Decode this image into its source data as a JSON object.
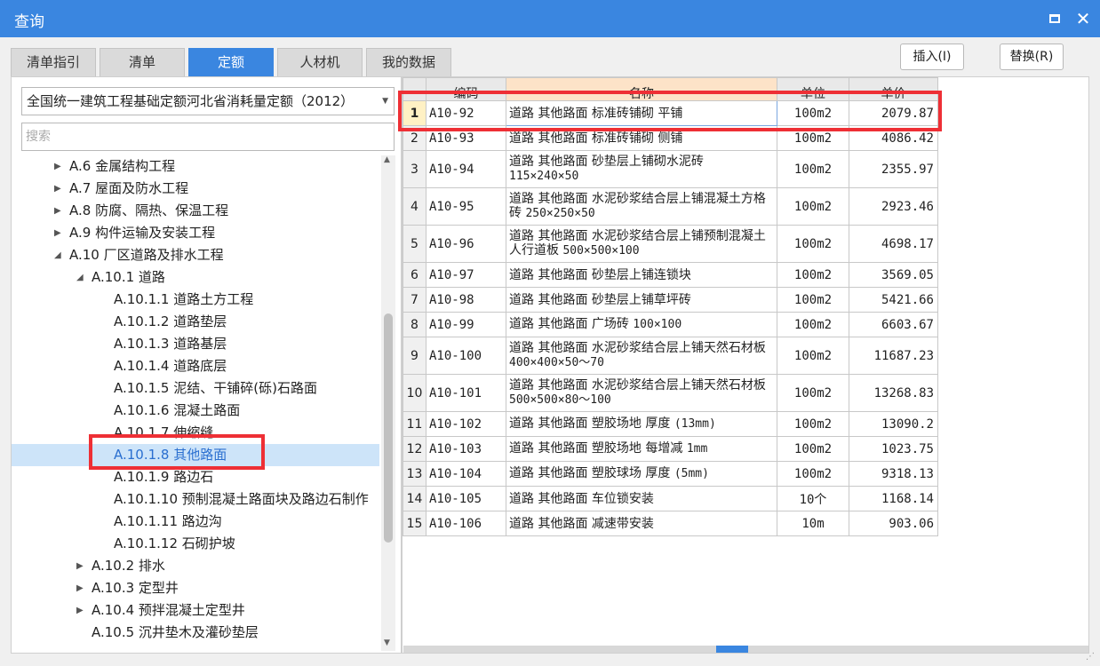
{
  "window": {
    "title": "查询"
  },
  "tabs": [
    {
      "label": "清单指引",
      "active": false
    },
    {
      "label": "清单",
      "active": false
    },
    {
      "label": "定额",
      "active": true
    },
    {
      "label": "人材机",
      "active": false
    },
    {
      "label": "我的数据",
      "active": false
    }
  ],
  "toolbar": {
    "insert_label": "插入(I)",
    "replace_label": "替换(R)"
  },
  "left": {
    "dropdown_value": "全国统一建筑工程基础定额河北省消耗量定额（2012）",
    "search_placeholder": "搜索",
    "tree": [
      {
        "label": "A.6 金属结构工程",
        "level": 0,
        "arrow": "collapsed"
      },
      {
        "label": "A.7 屋面及防水工程",
        "level": 0,
        "arrow": "collapsed"
      },
      {
        "label": "A.8 防腐、隔热、保温工程",
        "level": 0,
        "arrow": "collapsed"
      },
      {
        "label": "A.9 构件运输及安装工程",
        "level": 0,
        "arrow": "collapsed"
      },
      {
        "label": "A.10 厂区道路及排水工程",
        "level": 0,
        "arrow": "expanded"
      },
      {
        "label": "A.10.1 道路",
        "level": 1,
        "arrow": "expanded"
      },
      {
        "label": "A.10.1.1 道路土方工程",
        "level": 2,
        "arrow": "none"
      },
      {
        "label": "A.10.1.2 道路垫层",
        "level": 2,
        "arrow": "none"
      },
      {
        "label": "A.10.1.3 道路基层",
        "level": 2,
        "arrow": "none"
      },
      {
        "label": "A.10.1.4 道路底层",
        "level": 2,
        "arrow": "none"
      },
      {
        "label": "A.10.1.5 泥结、干铺碎(砾)石路面",
        "level": 2,
        "arrow": "none"
      },
      {
        "label": "A.10.1.6 混凝土路面",
        "level": 2,
        "arrow": "none"
      },
      {
        "label": "A.10.1.7 伸缩缝",
        "level": 2,
        "arrow": "none"
      },
      {
        "label": "A.10.1.8 其他路面",
        "level": 2,
        "arrow": "none",
        "selected": true
      },
      {
        "label": "A.10.1.9 路边石",
        "level": 2,
        "arrow": "none"
      },
      {
        "label": "A.10.1.10 预制混凝土路面块及路边石制作",
        "level": 2,
        "arrow": "none"
      },
      {
        "label": "A.10.1.11 路边沟",
        "level": 2,
        "arrow": "none"
      },
      {
        "label": "A.10.1.12 石砌护坡",
        "level": 2,
        "arrow": "none"
      },
      {
        "label": "A.10.2 排水",
        "level": 1,
        "arrow": "collapsed"
      },
      {
        "label": "A.10.3 定型井",
        "level": 1,
        "arrow": "collapsed"
      },
      {
        "label": "A.10.4 预拌混凝土定型井",
        "level": 1,
        "arrow": "collapsed"
      },
      {
        "label": "A.10.5 沉井垫木及灌砂垫层",
        "level": 1,
        "arrow": "none"
      }
    ]
  },
  "table": {
    "headers": {
      "code": "编码",
      "name": "名称",
      "unit": "单位",
      "price": "单价"
    },
    "rows": [
      {
        "idx": "1",
        "code": "A10-92",
        "name": "道路 其他路面 标准砖铺砌 平铺",
        "spec": "",
        "unit": "100m2",
        "price": "2079.87"
      },
      {
        "idx": "2",
        "code": "A10-93",
        "name": "道路 其他路面 标准砖铺砌 侧铺",
        "spec": "",
        "unit": "100m2",
        "price": "4086.42"
      },
      {
        "idx": "3",
        "code": "A10-94",
        "name": "道路 其他路面 砂垫层上铺砌水泥砖",
        "spec": "115×240×50",
        "unit": "100m2",
        "price": "2355.97"
      },
      {
        "idx": "4",
        "code": "A10-95",
        "name": "道路 其他路面 水泥砂浆结合层上铺混凝土方格砖",
        "spec": "250×250×50",
        "unit": "100m2",
        "price": "2923.46"
      },
      {
        "idx": "5",
        "code": "A10-96",
        "name": "道路 其他路面 水泥砂浆结合层上铺预制混凝土人行道板",
        "spec": "500×500×100",
        "unit": "100m2",
        "price": "4698.17"
      },
      {
        "idx": "6",
        "code": "A10-97",
        "name": "道路 其他路面 砂垫层上铺连锁块",
        "spec": "",
        "unit": "100m2",
        "price": "3569.05"
      },
      {
        "idx": "7",
        "code": "A10-98",
        "name": "道路 其他路面 砂垫层上铺草坪砖",
        "spec": "",
        "unit": "100m2",
        "price": "5421.66"
      },
      {
        "idx": "8",
        "code": "A10-99",
        "name": "道路 其他路面 广场砖",
        "spec": "100×100",
        "unit": "100m2",
        "price": "6603.67"
      },
      {
        "idx": "9",
        "code": "A10-100",
        "name": "道路 其他路面 水泥砂浆结合层上铺天然石材板",
        "spec": "400×400×50～70",
        "unit": "100m2",
        "price": "11687.23"
      },
      {
        "idx": "10",
        "code": "A10-101",
        "name": "道路 其他路面 水泥砂浆结合层上铺天然石材板",
        "spec": "500×500×80～100",
        "unit": "100m2",
        "price": "13268.83"
      },
      {
        "idx": "11",
        "code": "A10-102",
        "name": "道路 其他路面 塑胶场地 厚度",
        "spec": "(13mm)",
        "unit": "100m2",
        "price": "13090.2"
      },
      {
        "idx": "12",
        "code": "A10-103",
        "name": "道路 其他路面 塑胶场地 每增减",
        "spec": "1mm",
        "unit": "100m2",
        "price": "1023.75"
      },
      {
        "idx": "13",
        "code": "A10-104",
        "name": "道路 其他路面 塑胶球场 厚度",
        "spec": "(5mm)",
        "unit": "100m2",
        "price": "9318.13"
      },
      {
        "idx": "14",
        "code": "A10-105",
        "name": "道路 其他路面 车位锁安装",
        "spec": "",
        "unit": "10个",
        "price": "1168.14"
      },
      {
        "idx": "15",
        "code": "A10-106",
        "name": "道路 其他路面 减速带安装",
        "spec": "",
        "unit": "10m",
        "price": "903.06"
      }
    ],
    "selected_row": "1"
  },
  "colors": {
    "accent": "#3a86e0",
    "highlight": "#ee2f35"
  }
}
